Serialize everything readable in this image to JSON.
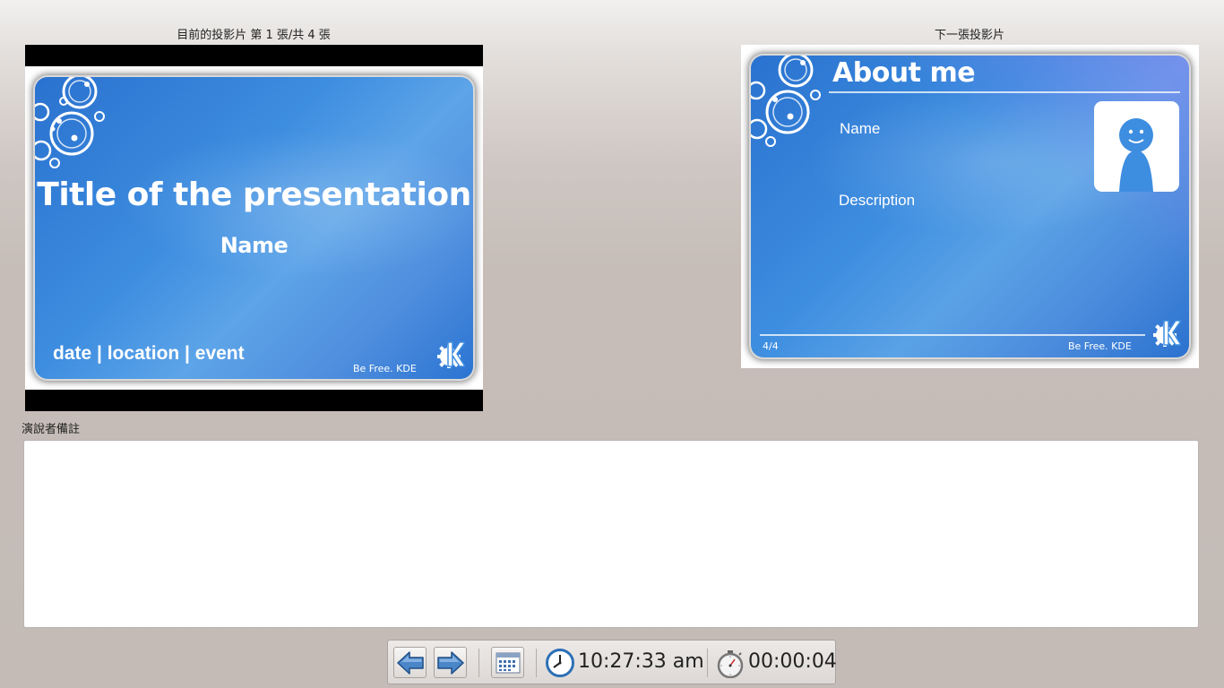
{
  "current_slide": {
    "header": "目前的投影片 第 1 張/共 4 張",
    "title": "Title of the presentation",
    "subtitle": "Name",
    "footer": "date | location | event",
    "tagline": "Be Free. KDE"
  },
  "next_slide": {
    "header": "下一張投影片",
    "title": "About me",
    "name_label": "Name",
    "description_label": "Description",
    "page": "4/4",
    "tagline": "Be Free. KDE"
  },
  "notes": {
    "header": "演說者備註",
    "content": ""
  },
  "toolbar": {
    "clock": "10:27:33 am",
    "timer": "00:00:04",
    "icons": [
      "arrow-left-icon",
      "arrow-right-icon",
      "calendar-grid-icon",
      "clock-icon",
      "stopwatch-icon"
    ]
  },
  "colors": {
    "slide_blue": "#3d8de0",
    "arrow_blue": "#4a86c8"
  }
}
